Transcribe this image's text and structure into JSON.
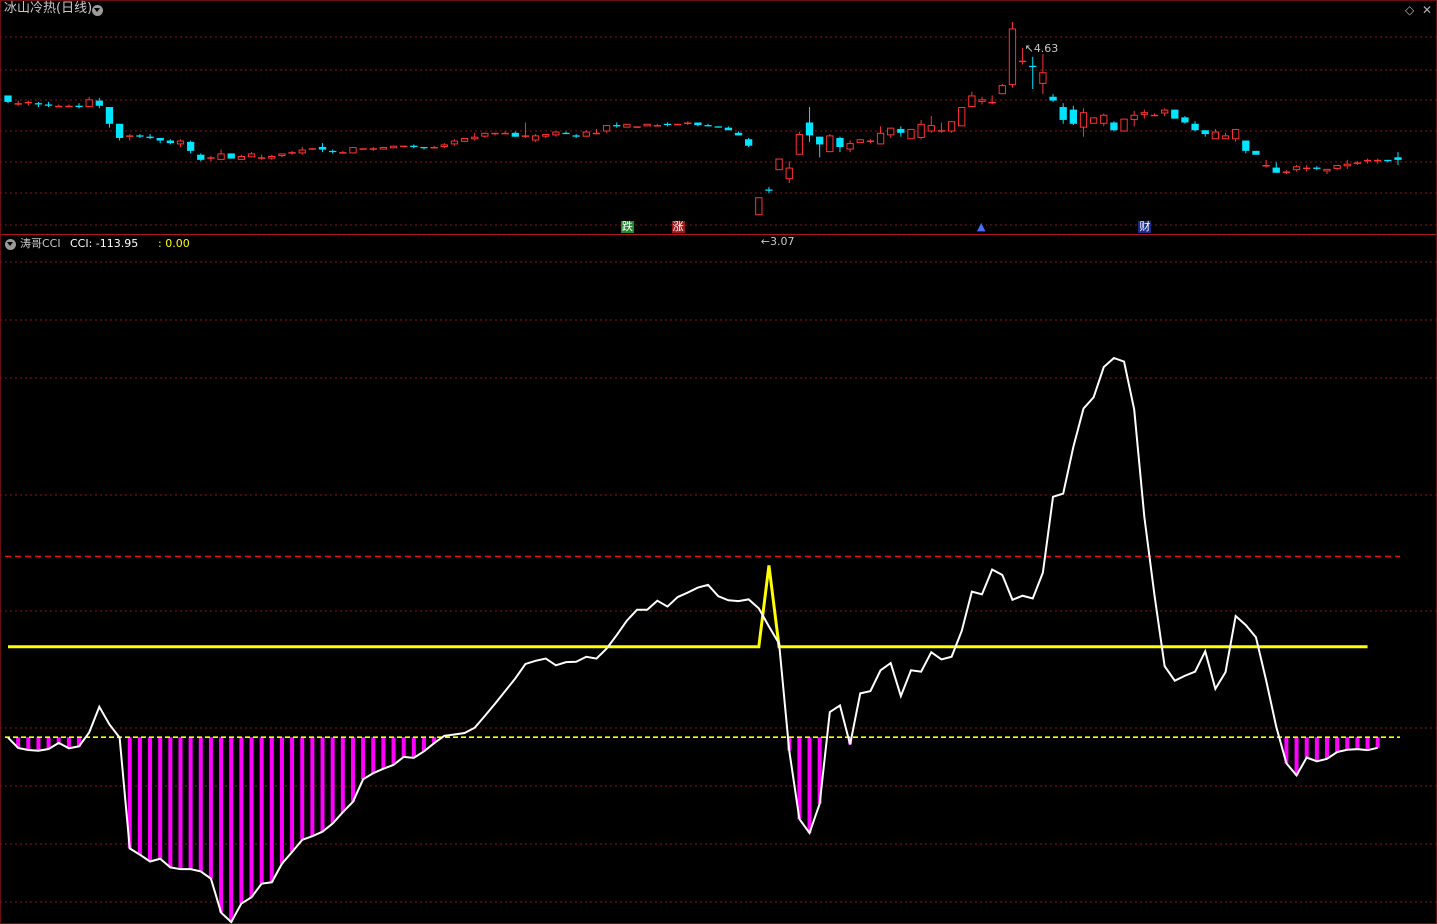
{
  "main_panel": {
    "title": "冰山冷热(日线)",
    "price_high_label": "4.63",
    "price_low_label": "3.07",
    "signals": [
      {
        "text": "跌",
        "bg": "#1e8a2a",
        "color": "#ffffff",
        "bar_index": 61
      },
      {
        "text": "涨",
        "bg": "#9a1a1a",
        "color": "#ffffff",
        "bar_index": 66
      },
      {
        "text": "▲",
        "bg": "#000000",
        "color": "#4a6cff",
        "bar_index": 96
      },
      {
        "text": "财",
        "bg": "#1a2a8a",
        "color": "#ffffff",
        "bar_index": 112
      }
    ],
    "icons": [
      "diamond-icon",
      "close-icon"
    ]
  },
  "sub_panel": {
    "indicator": "涛哥CCI",
    "cci_label": "CCI: -113.95",
    "line2_label": ": 0.00"
  },
  "colors": {
    "up": "#ff3232",
    "down": "#00e5ff",
    "grid": "#8a1414",
    "cci_line": "#ffffff",
    "yellow": "#ffff00",
    "bar": "#ff00ff",
    "red_dash": "#e01010"
  },
  "chart_data": {
    "type": "line",
    "main": {
      "type": "candlestick",
      "ohlc": [
        [
          4.06,
          4.06,
          4.0,
          4.01
        ],
        [
          4.0,
          4.02,
          3.98,
          4.0
        ],
        [
          4.0,
          4.02,
          3.98,
          4.01
        ],
        [
          4.0,
          4.01,
          3.97,
          3.99
        ],
        [
          3.99,
          4.01,
          3.97,
          3.98
        ],
        [
          3.98,
          3.99,
          3.97,
          3.98
        ],
        [
          3.98,
          3.99,
          3.97,
          3.98
        ],
        [
          3.98,
          4.0,
          3.96,
          3.97
        ],
        [
          3.97,
          4.05,
          3.97,
          4.03
        ],
        [
          4.02,
          4.04,
          3.96,
          3.98
        ],
        [
          3.97,
          3.97,
          3.81,
          3.84
        ],
        [
          3.84,
          3.84,
          3.71,
          3.73
        ],
        [
          3.74,
          3.76,
          3.71,
          3.75
        ],
        [
          3.75,
          3.76,
          3.73,
          3.74
        ],
        [
          3.74,
          3.76,
          3.72,
          3.73
        ],
        [
          3.73,
          3.73,
          3.69,
          3.71
        ],
        [
          3.71,
          3.72,
          3.68,
          3.69
        ],
        [
          3.68,
          3.72,
          3.66,
          3.71
        ],
        [
          3.7,
          3.71,
          3.61,
          3.63
        ],
        [
          3.6,
          3.61,
          3.55,
          3.56
        ],
        [
          3.58,
          3.59,
          3.55,
          3.58
        ],
        [
          3.56,
          3.64,
          3.56,
          3.61
        ],
        [
          3.61,
          3.61,
          3.57,
          3.57
        ],
        [
          3.56,
          3.6,
          3.56,
          3.59
        ],
        [
          3.58,
          3.62,
          3.58,
          3.61
        ],
        [
          3.58,
          3.6,
          3.56,
          3.58
        ],
        [
          3.57,
          3.6,
          3.56,
          3.59
        ],
        [
          3.59,
          3.61,
          3.58,
          3.61
        ],
        [
          3.61,
          3.63,
          3.6,
          3.62
        ],
        [
          3.61,
          3.66,
          3.6,
          3.64
        ],
        [
          3.64,
          3.65,
          3.64,
          3.65
        ],
        [
          3.66,
          3.69,
          3.62,
          3.64
        ],
        [
          3.63,
          3.64,
          3.61,
          3.62
        ],
        [
          3.62,
          3.63,
          3.61,
          3.62
        ],
        [
          3.61,
          3.66,
          3.61,
          3.66
        ],
        [
          3.64,
          3.65,
          3.64,
          3.65
        ],
        [
          3.65,
          3.66,
          3.63,
          3.65
        ],
        [
          3.64,
          3.66,
          3.64,
          3.66
        ],
        [
          3.65,
          3.67,
          3.65,
          3.67
        ],
        [
          3.66,
          3.67,
          3.66,
          3.67
        ],
        [
          3.67,
          3.68,
          3.65,
          3.66
        ],
        [
          3.66,
          3.66,
          3.64,
          3.65
        ],
        [
          3.66,
          3.67,
          3.65,
          3.66
        ],
        [
          3.66,
          3.69,
          3.65,
          3.68
        ],
        [
          3.68,
          3.72,
          3.67,
          3.71
        ],
        [
          3.7,
          3.73,
          3.7,
          3.73
        ],
        [
          3.72,
          3.77,
          3.71,
          3.74
        ],
        [
          3.74,
          3.77,
          3.73,
          3.77
        ],
        [
          3.76,
          3.77,
          3.75,
          3.77
        ],
        [
          3.77,
          3.78,
          3.76,
          3.77
        ],
        [
          3.77,
          3.78,
          3.74,
          3.74
        ],
        [
          3.74,
          3.85,
          3.73,
          3.75
        ],
        [
          3.71,
          3.76,
          3.7,
          3.75
        ],
        [
          3.74,
          3.76,
          3.73,
          3.76
        ],
        [
          3.75,
          3.78,
          3.74,
          3.78
        ],
        [
          3.77,
          3.78,
          3.76,
          3.76
        ],
        [
          3.75,
          3.76,
          3.73,
          3.74
        ],
        [
          3.74,
          3.79,
          3.74,
          3.78
        ],
        [
          3.77,
          3.8,
          3.76,
          3.77
        ],
        [
          3.78,
          3.83,
          3.77,
          3.83
        ],
        [
          3.83,
          3.85,
          3.81,
          3.82
        ],
        [
          3.81,
          3.84,
          3.82,
          3.84
        ],
        [
          3.81,
          3.82,
          3.81,
          3.82
        ],
        [
          3.82,
          3.84,
          3.82,
          3.84
        ],
        [
          3.83,
          3.84,
          3.82,
          3.83
        ],
        [
          3.84,
          3.85,
          3.82,
          3.83
        ],
        [
          3.84,
          3.84,
          3.83,
          3.84
        ],
        [
          3.84,
          3.86,
          3.83,
          3.85
        ],
        [
          3.85,
          3.85,
          3.82,
          3.83
        ],
        [
          3.83,
          3.84,
          3.82,
          3.82
        ],
        [
          3.82,
          3.82,
          3.81,
          3.81
        ],
        [
          3.81,
          3.82,
          3.79,
          3.79
        ],
        [
          3.77,
          3.78,
          3.75,
          3.75
        ],
        [
          3.72,
          3.73,
          3.66,
          3.67
        ],
        [
          3.13,
          3.27,
          3.13,
          3.27
        ],
        [
          3.33,
          3.35,
          3.3,
          3.32
        ],
        [
          3.48,
          3.57,
          3.48,
          3.57
        ],
        [
          3.41,
          3.55,
          3.38,
          3.5
        ],
        [
          3.6,
          3.78,
          3.6,
          3.76
        ],
        [
          3.85,
          3.97,
          3.7,
          3.75
        ],
        [
          3.74,
          3.74,
          3.58,
          3.68
        ],
        [
          3.62,
          3.76,
          3.62,
          3.75
        ],
        [
          3.73,
          3.74,
          3.62,
          3.66
        ],
        [
          3.64,
          3.71,
          3.62,
          3.69
        ],
        [
          3.69,
          3.72,
          3.69,
          3.72
        ],
        [
          3.71,
          3.72,
          3.69,
          3.71
        ],
        [
          3.68,
          3.82,
          3.68,
          3.77
        ],
        [
          3.75,
          3.81,
          3.73,
          3.81
        ],
        [
          3.8,
          3.82,
          3.74,
          3.77
        ],
        [
          3.72,
          3.8,
          3.73,
          3.8
        ],
        [
          3.73,
          3.87,
          3.72,
          3.84
        ],
        [
          3.78,
          3.9,
          3.77,
          3.83
        ],
        [
          3.79,
          3.85,
          3.77,
          3.79
        ],
        [
          3.78,
          3.86,
          3.77,
          3.86
        ],
        [
          3.82,
          3.97,
          3.82,
          3.97
        ],
        [
          3.97,
          4.09,
          3.99,
          4.06
        ],
        [
          4.01,
          4.05,
          3.99,
          4.03
        ],
        [
          4.0,
          4.06,
          3.99,
          4.01
        ],
        [
          4.07,
          4.15,
          4.07,
          4.14
        ],
        [
          4.14,
          4.63,
          4.12,
          4.58
        ],
        [
          4.33,
          4.43,
          4.3,
          4.33
        ],
        [
          4.29,
          4.36,
          4.11,
          4.28
        ],
        [
          4.15,
          4.38,
          4.07,
          4.24
        ],
        [
          4.05,
          4.07,
          4.01,
          4.02
        ],
        [
          3.97,
          4.0,
          3.84,
          3.87
        ],
        [
          3.95,
          3.98,
          3.83,
          3.84
        ],
        [
          3.81,
          3.96,
          3.74,
          3.93
        ],
        [
          3.84,
          3.89,
          3.86,
          3.89
        ],
        [
          3.84,
          3.92,
          3.82,
          3.91
        ],
        [
          3.85,
          3.86,
          3.78,
          3.79
        ],
        [
          3.78,
          3.88,
          3.79,
          3.88
        ],
        [
          3.87,
          3.94,
          3.82,
          3.91
        ],
        [
          3.91,
          3.95,
          3.88,
          3.93
        ],
        [
          3.9,
          3.92,
          3.9,
          3.91
        ],
        [
          3.92,
          3.96,
          3.9,
          3.95
        ],
        [
          3.95,
          3.95,
          3.88,
          3.88
        ],
        [
          3.89,
          3.9,
          3.84,
          3.85
        ],
        [
          3.84,
          3.86,
          3.78,
          3.79
        ],
        [
          3.79,
          3.79,
          3.74,
          3.76
        ],
        [
          3.72,
          3.8,
          3.73,
          3.78
        ],
        [
          3.72,
          3.77,
          3.72,
          3.75
        ],
        [
          3.72,
          3.8,
          3.7,
          3.8
        ],
        [
          3.71,
          3.71,
          3.61,
          3.63
        ],
        [
          3.63,
          3.63,
          3.6,
          3.6
        ],
        [
          3.52,
          3.56,
          3.5,
          3.52
        ],
        [
          3.5,
          3.54,
          3.46,
          3.46
        ],
        [
          3.46,
          3.48,
          3.45,
          3.47
        ],
        [
          3.48,
          3.52,
          3.47,
          3.51
        ],
        [
          3.5,
          3.52,
          3.47,
          3.5
        ],
        [
          3.5,
          3.51,
          3.48,
          3.49
        ],
        [
          3.47,
          3.49,
          3.45,
          3.49
        ],
        [
          3.49,
          3.52,
          3.48,
          3.52
        ],
        [
          3.51,
          3.56,
          3.49,
          3.53
        ],
        [
          3.53,
          3.55,
          3.52,
          3.54
        ],
        [
          3.55,
          3.57,
          3.53,
          3.56
        ],
        [
          3.55,
          3.57,
          3.53,
          3.56
        ],
        [
          3.56,
          3.56,
          3.54,
          3.55
        ],
        [
          3.58,
          3.62,
          3.52,
          3.56
        ]
      ],
      "high_label_index": 100,
      "low_label_index": 74
    },
    "sub": {
      "cci": [
        -0.7,
        -23.8,
        -28.3,
        -30.0,
        -26.1,
        -12.5,
        -24.5,
        -20.2,
        10.5,
        67.3,
        28.2,
        -1.05,
        -246,
        -260,
        -275,
        -269,
        -288,
        -292,
        -292,
        -297,
        -313,
        -388,
        -409,
        -368,
        -354,
        -324,
        -321,
        -280,
        -254,
        -227,
        -219,
        -209,
        -191,
        -166,
        -143,
        -93.1,
        -79.6,
        -69.6,
        -61.3,
        -43.5,
        -45.8,
        -31.3,
        -13.3,
        3.05,
        6.08,
        9.19,
        20.9,
        47.2,
        73.9,
        102,
        130,
        162,
        169,
        174,
        159,
        166,
        167,
        178,
        174,
        196,
        226,
        258,
        282,
        282,
        302,
        289,
        310,
        320,
        331,
        337,
        312,
        303,
        301,
        305,
        285,
        245,
        207,
        -29.6,
        -181,
        -212,
        -147,
        55.6,
        70.3,
        -16.1,
        97.0,
        102,
        148,
        164,
        91,
        148,
        145,
        188,
        172,
        178,
        235,
        322,
        316,
        371,
        359,
        304,
        313,
        307,
        364,
        532,
        539,
        642,
        727,
        752,
        819,
        839,
        831,
        725,
        487,
        314,
        157,
        125,
        136,
        145,
        190,
        107,
        144,
        268,
        248,
        221,
        126,
        23.1,
        -57.6,
        -84.5,
        -45.0,
        -53.4,
        -47.8,
        -32.8,
        -27.8,
        -26.4,
        -28.7,
        -23.5
      ],
      "yellow_line": [
        200,
        200,
        200,
        200,
        200,
        200,
        200,
        200,
        200,
        200,
        200,
        200,
        200,
        200,
        200,
        200,
        200,
        200,
        200,
        200,
        200,
        200,
        200,
        200,
        200,
        200,
        200,
        200,
        200,
        200,
        200,
        200,
        200,
        200,
        200,
        200,
        200,
        200,
        200,
        200,
        200,
        200,
        200,
        200,
        200,
        200,
        200,
        200,
        200,
        200,
        200,
        200,
        200,
        200,
        200,
        200,
        200,
        200,
        200,
        200,
        200,
        200,
        200,
        200,
        200,
        200,
        200,
        200,
        200,
        200,
        200,
        200,
        200,
        200,
        200,
        380,
        200,
        200,
        200,
        200,
        200,
        200,
        200,
        200,
        200,
        200,
        200,
        200,
        200,
        200,
        200,
        200,
        200,
        200,
        200,
        200,
        200,
        200,
        200,
        200,
        200,
        200,
        200,
        200,
        200,
        200,
        200,
        200,
        200,
        200,
        200,
        200,
        200,
        200,
        200,
        200,
        200,
        200,
        200,
        200,
        200,
        200,
        200,
        200,
        200,
        200,
        200,
        200,
        200,
        200,
        200,
        200,
        200,
        200,
        200
      ],
      "red_ref": 400,
      "yellow_ref": 0,
      "ylim": [
        -400,
        1100
      ]
    }
  }
}
